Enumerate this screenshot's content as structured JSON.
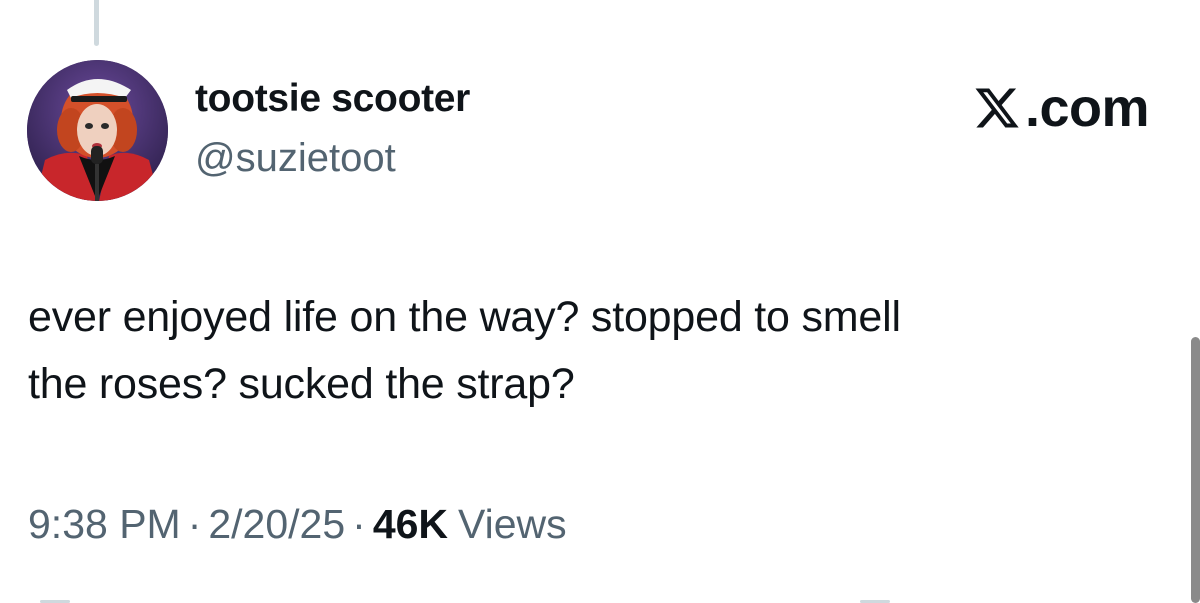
{
  "tweet": {
    "author": {
      "display_name": "tootsie scooter",
      "handle": "@suzietoot",
      "avatar_icon": "profile-photo"
    },
    "brand": {
      "icon": "x-logo-icon",
      "text": ".com"
    },
    "text": "ever enjoyed life on the way? stopped to smell\nthe roses? sucked the strap?",
    "meta": {
      "time": "9:38 PM",
      "separator": "·",
      "date": "2/20/25",
      "views_count": "46K",
      "views_label": "Views"
    }
  },
  "colors": {
    "text_primary": "#0f1419",
    "text_secondary": "#536471",
    "thread_line": "#cfd9de"
  }
}
